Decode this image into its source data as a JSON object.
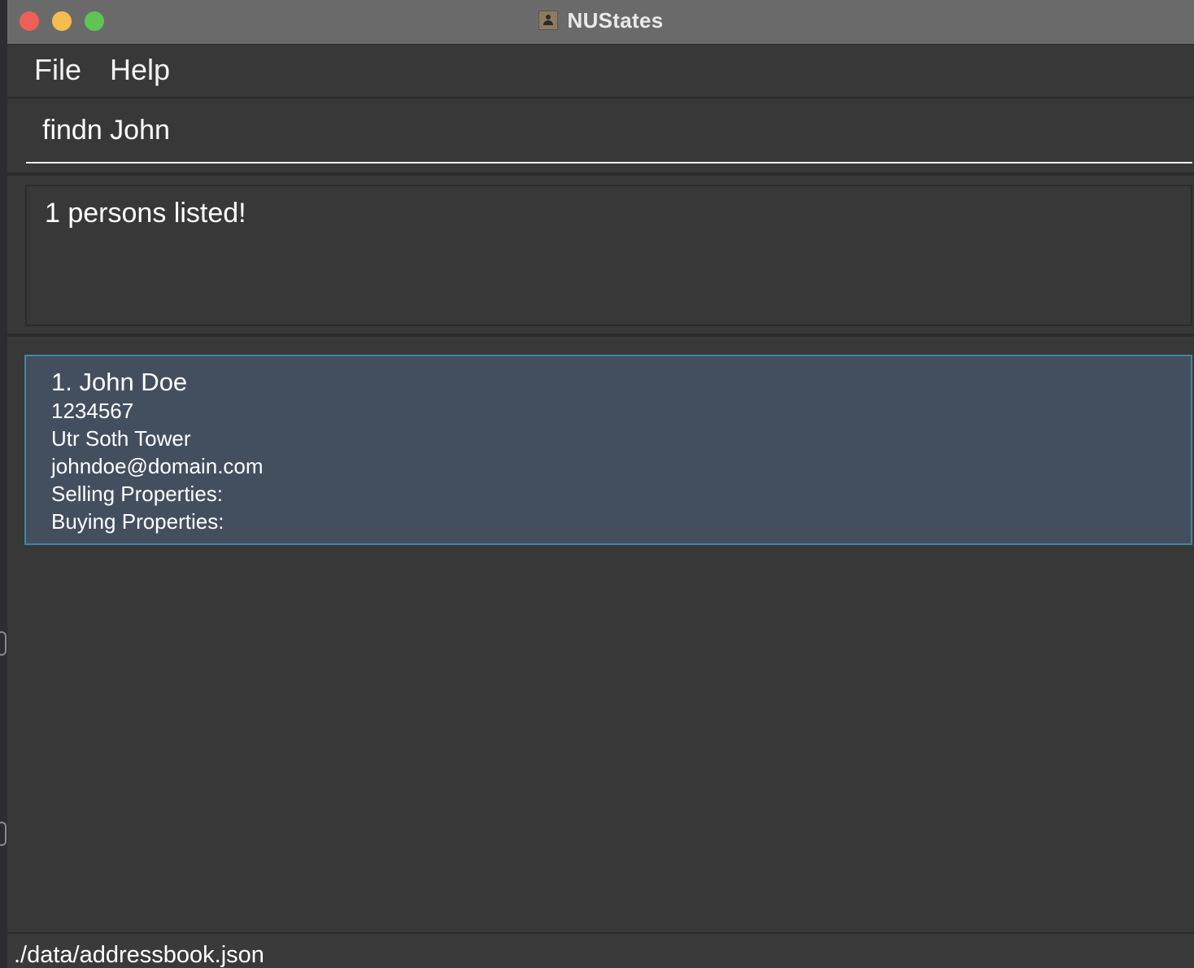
{
  "window": {
    "title": "NUStates"
  },
  "menu": {
    "file_label": "File",
    "help_label": "Help"
  },
  "command": {
    "value": "findn John"
  },
  "result": {
    "message": "1 persons listed!"
  },
  "persons": [
    {
      "index_name": "1. John Doe",
      "phone": "1234567",
      "address": "Utr Soth Tower",
      "email": "johndoe@domain.com",
      "selling_label": "Selling Properties:",
      "buying_label": "Buying Properties:"
    }
  ],
  "status": {
    "file_path": "./data/addressbook.json"
  },
  "colors": {
    "background": "#383838",
    "card_background": "#434f5f",
    "card_border": "#3a8aa0",
    "title_bar": "#6b6a6b"
  }
}
